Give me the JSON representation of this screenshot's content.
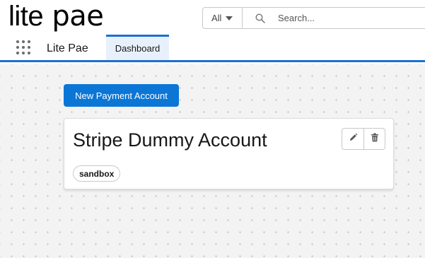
{
  "brand": {
    "logo_part1": "lite",
    "logo_part2": "pae"
  },
  "search": {
    "scope": "All",
    "placeholder": "Search..."
  },
  "nav": {
    "app_name": "Lite Pae",
    "tabs": [
      {
        "label": "Dashboard",
        "active": true
      }
    ]
  },
  "main": {
    "new_button_label": "New Payment Account",
    "account_card": {
      "title": "Stripe Dummy Account",
      "badge": "sandbox"
    }
  },
  "colors": {
    "accent": "#1b6fd1",
    "primary_button": "#0b76d6",
    "active_tab_bg": "#e8f1fb"
  },
  "icons": [
    "app-launcher-icon",
    "chevron-down-icon",
    "search-icon",
    "pencil-icon",
    "trash-icon"
  ]
}
